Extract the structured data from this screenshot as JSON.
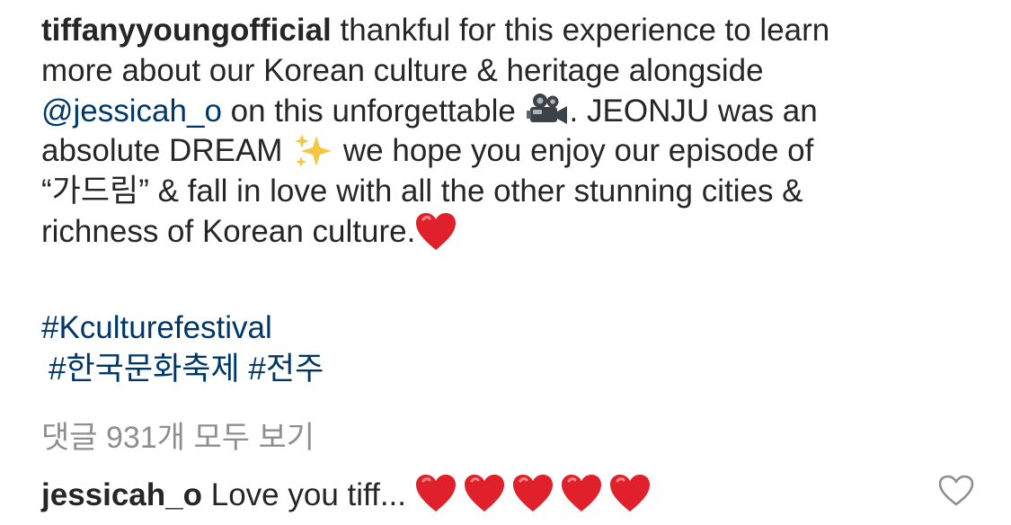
{
  "post": {
    "username": "tiffanyyoungofficial",
    "caption_lines": [
      {
        "before": " thankful for this experience to learn"
      },
      {
        "text": "more about our Korean culture & heritage alongside"
      },
      {
        "mention": "@jessicah_o",
        "after_mention": " on this unforgettable ",
        "after_emoji": ". JEONJU was an"
      },
      {
        "before": "absolute DREAM ",
        "after": "  we hope you enjoy our episode of"
      },
      {
        "text": "“가드림” & fall in love with all the other stunning cities &"
      },
      {
        "text": "richness of Korean culture."
      }
    ],
    "hashtags": [
      "#Kculturefestival",
      "#한국문화축제",
      "#전주"
    ],
    "view_all_comments": "댓글 931개 모두 보기"
  },
  "comment": {
    "username": "jessicah_o",
    "text": "Love you tiff...",
    "heart_count": 5
  },
  "icons": {
    "movie_camera": "movie-camera-emoji",
    "sparkles": "sparkles-emoji",
    "heart": "red-heart-emoji",
    "like": "heart-outline-icon"
  },
  "colors": {
    "text": "#262626",
    "link": "#00376b",
    "muted": "#8e8e8e",
    "heart": "#e0202a"
  }
}
